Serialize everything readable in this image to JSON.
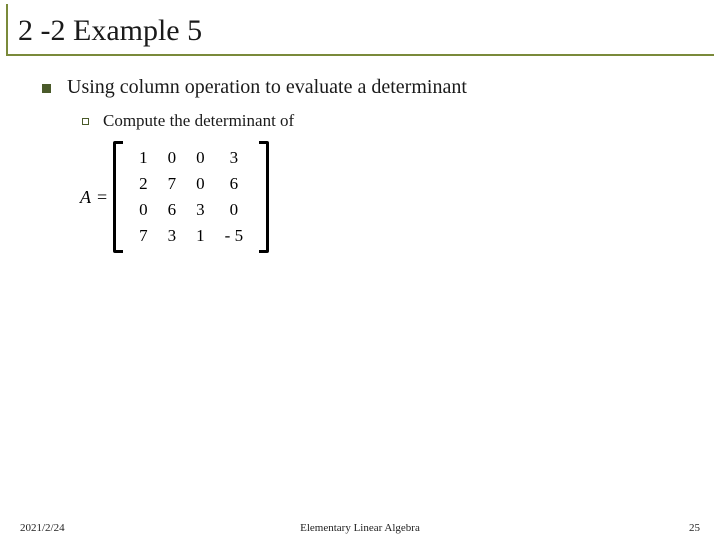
{
  "title": "2 -2 Example 5",
  "bullet1": "Using column operation to evaluate a determinant",
  "bullet2": "Compute the determinant of",
  "matrix": {
    "lhs": "A",
    "eq": "=",
    "rows": [
      [
        "1",
        "0",
        "0",
        "3"
      ],
      [
        "2",
        "7",
        "0",
        "6"
      ],
      [
        "0",
        "6",
        "3",
        "0"
      ],
      [
        "7",
        "3",
        "1",
        "- 5"
      ]
    ]
  },
  "footer": {
    "date": "2021/2/24",
    "center": "Elementary Linear Algebra",
    "page": "25"
  }
}
